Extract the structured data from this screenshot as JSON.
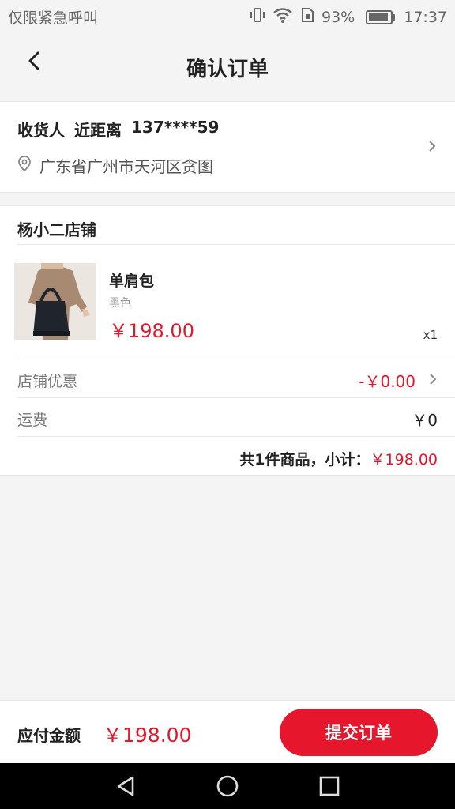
{
  "status": {
    "carrier": "仅限紧急呼叫",
    "battery": "93%",
    "battery_level": 0.93,
    "time": "17:37"
  },
  "nav": {
    "title": "确认订单"
  },
  "address": {
    "label": "收货人",
    "name": "近距离",
    "phone": "137****59",
    "location": "广东省广州市天河区贪图"
  },
  "store": {
    "name": "杨小二店铺",
    "product": {
      "title": "单肩包",
      "color": "黑色",
      "price": "￥198.00",
      "qty": "x1"
    },
    "discount": {
      "label": "店铺优惠",
      "value": "-￥0.00"
    },
    "shipping": {
      "label": "运费",
      "value": "￥0"
    },
    "subtotal": {
      "text": "共1件商品，小计：",
      "amount": "￥198.00"
    }
  },
  "footer": {
    "label": "应付金额",
    "amount": "￥198.00",
    "submit": "提交订单"
  },
  "colors": {
    "accent": "#e6162d"
  }
}
